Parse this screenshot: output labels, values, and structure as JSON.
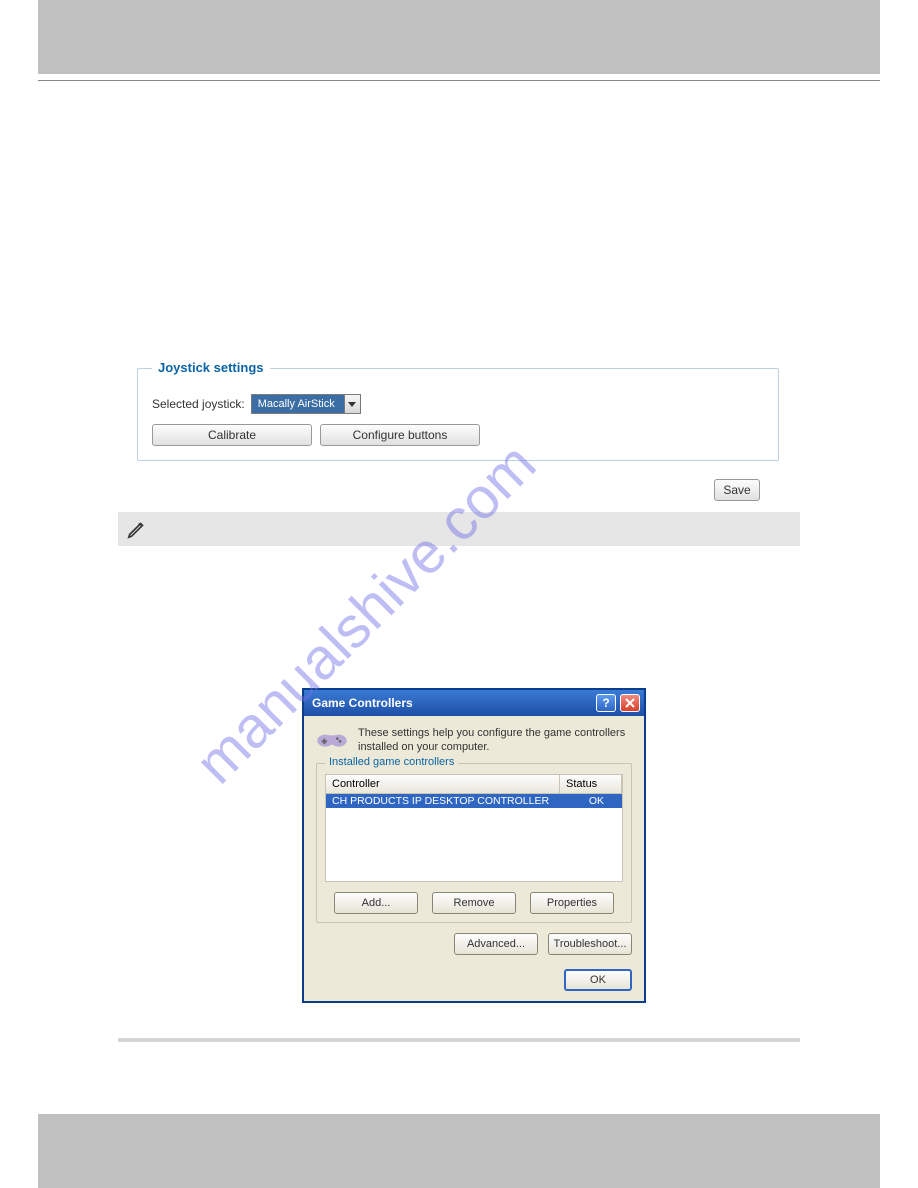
{
  "watermark": "manualshive.com",
  "joystick": {
    "group_title": "Joystick settings",
    "selected_label": "Selected joystick:",
    "selected_value": "Macally AirStick",
    "calibrate_label": "Calibrate",
    "configure_label": "Configure buttons",
    "save_label": "Save"
  },
  "dialog": {
    "title": "Game Controllers",
    "desc": "These settings help you configure the game controllers installed on your computer.",
    "fieldset_title": "Installed game controllers",
    "header_controller": "Controller",
    "header_status": "Status",
    "row_controller": "CH PRODUCTS IP DESKTOP CONTROLLER",
    "row_status": "OK",
    "add_label": "Add...",
    "remove_label": "Remove",
    "properties_label": "Properties",
    "advanced_label": "Advanced...",
    "troubleshoot_label": "Troubleshoot...",
    "ok_label": "OK"
  }
}
